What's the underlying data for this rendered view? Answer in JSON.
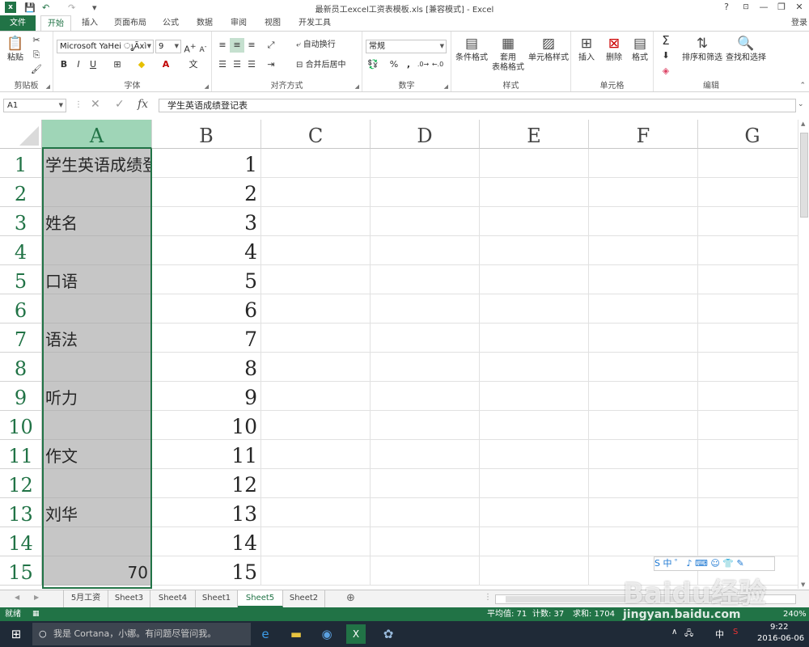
{
  "window": {
    "title": "最新员工excel工资表模板.xls  [兼容模式] - Excel",
    "help": "?",
    "minimize": "—",
    "restore": "❐",
    "close": "✕",
    "quick_access": [
      "x",
      "💾",
      "↶",
      "↷",
      "▾"
    ]
  },
  "tabs": [
    "文件",
    "开始",
    "插入",
    "页面布局",
    "公式",
    "数据",
    "审阅",
    "视图",
    "开发工具"
  ],
  "login": "登录",
  "ribbon": {
    "clipboard": {
      "label": "剪贴板",
      "paste": "粘贴"
    },
    "font": {
      "label": "字体",
      "name": "Microsoft YaHei ൃÃxì",
      "size": "9",
      "bold": "B",
      "italic": "I",
      "underline": "U"
    },
    "alignment": {
      "label": "对齐方式",
      "wrap": "自动换行",
      "merge": "合并后居中"
    },
    "number": {
      "label": "数字",
      "format": "常规",
      "percent": "%",
      "comma": ","
    },
    "styles": {
      "label": "样式",
      "cond": "条件格式",
      "table_line1": "套用",
      "table_line2": "表格格式",
      "cellstyle": "单元格样式"
    },
    "cells": {
      "label": "单元格",
      "insert": "插入",
      "delete": "删除",
      "format": "格式"
    },
    "editing": {
      "label": "编辑",
      "sort": "排序和筛选",
      "find": "查找和选择",
      "sigma": "Σ"
    }
  },
  "formula_bar": {
    "name_box": "A1",
    "fx": "fx",
    "value": "学生英语成绩登记表"
  },
  "columns": [
    "A",
    "B",
    "C",
    "D",
    "E",
    "F",
    "G"
  ],
  "rows": [
    "1",
    "2",
    "3",
    "4",
    "5",
    "6",
    "7",
    "8",
    "9",
    "10",
    "11",
    "12",
    "13",
    "14",
    "15"
  ],
  "col_a": [
    "学生英语成绩登记表",
    "",
    "姓名",
    "",
    "口语",
    "",
    "语法",
    "",
    "听力",
    "",
    "作文",
    "",
    "刘华",
    "",
    "70"
  ],
  "col_b": [
    "1",
    "2",
    "3",
    "4",
    "5",
    "6",
    "7",
    "8",
    "9",
    "10",
    "11",
    "12",
    "13",
    "14",
    "15"
  ],
  "sheet_tabs": [
    "5月工资",
    "Sheet3",
    "Sheet4",
    "Sheet1",
    "Sheet5",
    "Sheet2"
  ],
  "active_sheet": "Sheet5",
  "add_sheet": "⊕",
  "status": {
    "ready": "就绪",
    "average": "平均值: 71",
    "count": "计数: 37",
    "sum": "求和: 1704",
    "zoom": "240%"
  },
  "taskbar": {
    "cortana": "我是 Cortana，小娜。有问题尽管问我。",
    "time": "9:22",
    "date": "2016-06-06",
    "ime": "中"
  },
  "ime_bar": "S 中 ゜ ♪ ⌨ ☺ 👕 ✎",
  "watermark": "Baidu经验",
  "watermark_url": "jingyan.baidu.com",
  "colors": {
    "accent": "#217346",
    "selected_col": "#9fd5b7",
    "selected_cells": "#c6c6c6"
  }
}
